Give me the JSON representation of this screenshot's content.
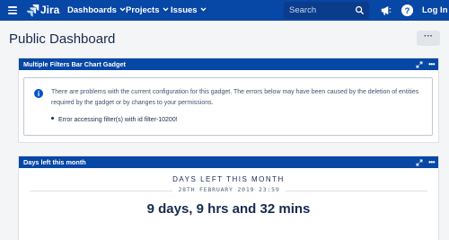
{
  "nav": {
    "logo_text": "Jira",
    "items": [
      "Dashboards",
      "Projects",
      "Issues"
    ],
    "search_placeholder": "Search",
    "login_label": "Log In"
  },
  "page": {
    "title": "Public Dashboard",
    "more_label": "···"
  },
  "gadgets": [
    {
      "title": "Multiple Filters Bar Chart Gadget",
      "message": "There are problems with the current configuration for this gadget. The errors below may have been caused by the deletion of entities required by the gadget or by changes to your permissions.",
      "errors": [
        "Error accessing filter(s) with id filter-10200!"
      ]
    },
    {
      "title": "Days left this month",
      "heading": "DAYS LEFT THIS MONTH",
      "date": "28TH FEBRUARY 2019 23:59",
      "value": "9 days, 9 hrs and 32 mins"
    }
  ],
  "colors": {
    "nav_bg": "#0747a6",
    "page_bg": "#f4f5f7",
    "info_blue": "#0052cc"
  }
}
